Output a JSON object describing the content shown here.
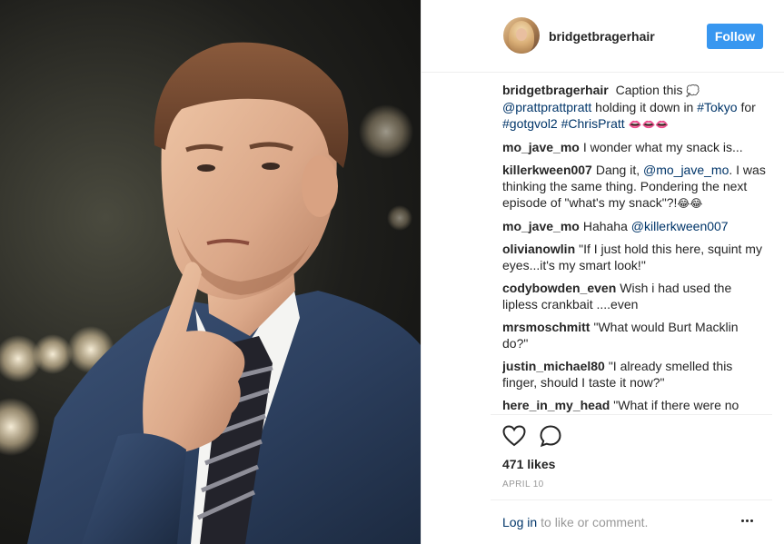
{
  "post": {
    "username": "bridgetbragerhair",
    "follow_label": "Follow"
  },
  "caption": {
    "author": "bridgetbragerhair",
    "text_1": "Caption this",
    "emoji_1": "💭",
    "mention": "@prattprattpratt",
    "text_2": "holding it down in",
    "tag_1": "#Tokyo",
    "text_3": "for",
    "tag_2": "#gotgvol2",
    "tag_3": "#ChrisPratt",
    "emoji_2": "👄👄👄"
  },
  "comments": [
    {
      "author": "mo_jave_mo",
      "text": "I wonder what my snack is..."
    },
    {
      "author": "killerkween007",
      "text_1": "Dang it,",
      "mention": "@mo_jave_mo",
      "text_2": ". I was thinking the same thing. Pondering the next episode of \"what's my snack\"?!",
      "emoji": "😂😂"
    },
    {
      "author": "mo_jave_mo",
      "text": "Hahaha",
      "mention": "@killerkween007"
    },
    {
      "author": "olivianowlin",
      "text": "\"If I just hold this here, squint my eyes...it's my smart look!\""
    },
    {
      "author": "codybowden_even",
      "text": "Wish i had used the lipless crankbait ....even"
    },
    {
      "author": "mrsmoschmitt",
      "text": "\"What would Burt Macklin do?\""
    },
    {
      "author": "justin_michael80",
      "text": "\"I already smelled this finger, should I taste it now?\""
    },
    {
      "author": "here_in_my_head",
      "text": "\"What if there were no hypothetical questions?\"",
      "emoji": "🤔"
    }
  ],
  "actions": {
    "like_icon": "heart-icon",
    "comment_icon": "speech-bubble-icon",
    "likes_text": "471 likes",
    "date_text": "APRIL 10"
  },
  "footer": {
    "login_label": "Log in",
    "login_suffix": "to like or comment.",
    "more_icon": "ellipsis-icon"
  },
  "colors": {
    "follow_button": "#3897f0",
    "link": "#003569",
    "muted": "#999999",
    "text": "#262626",
    "suit": "#2c3f5e"
  }
}
